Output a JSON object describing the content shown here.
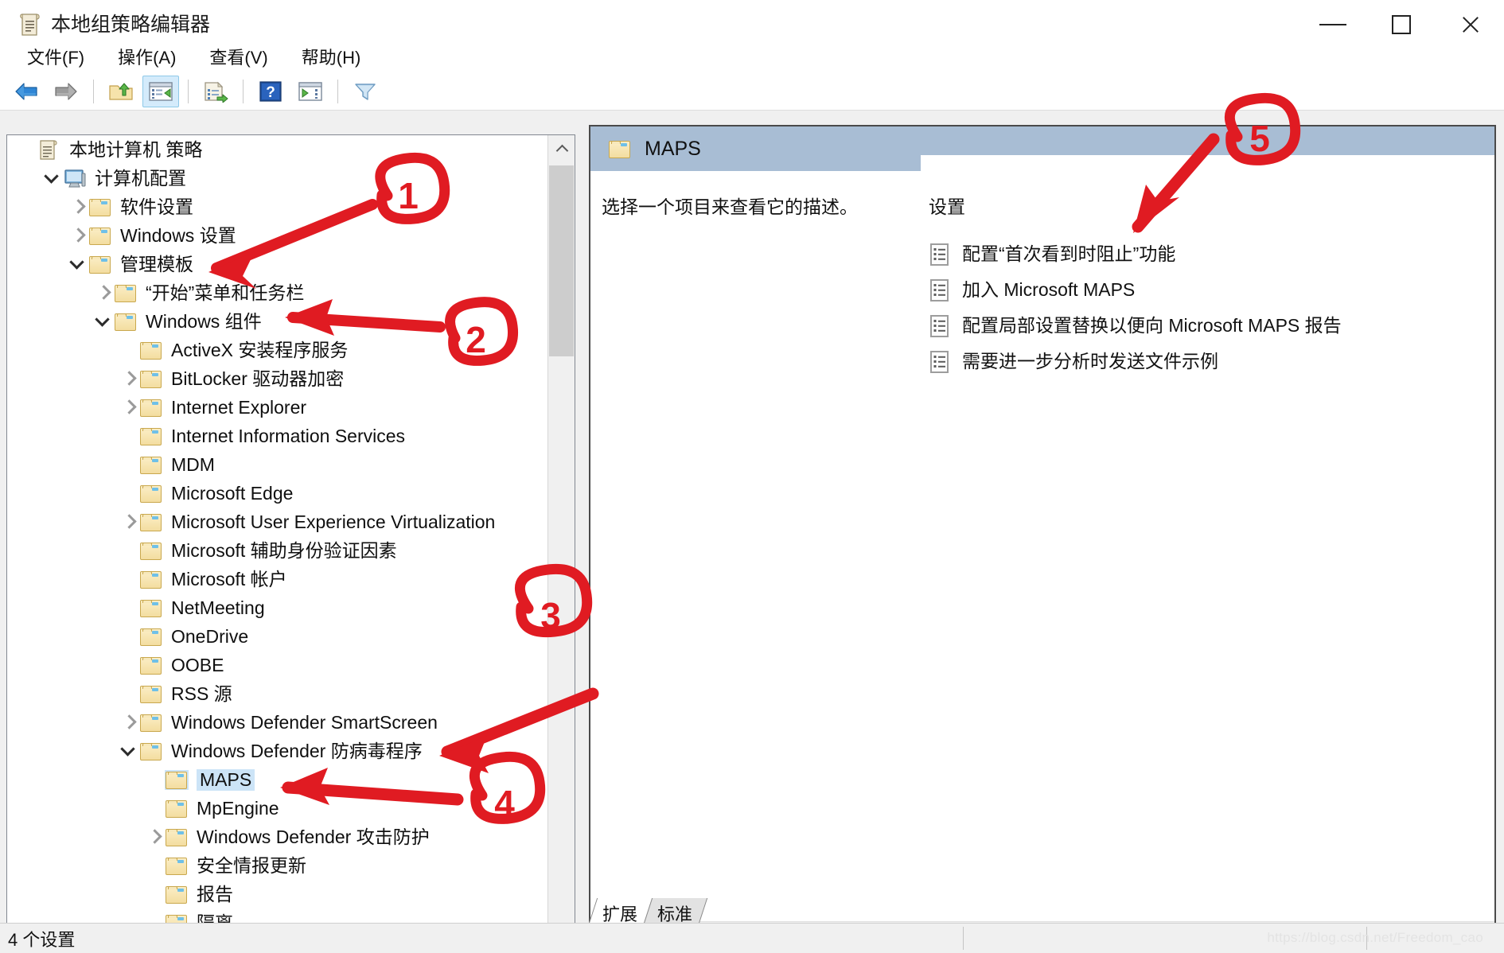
{
  "window": {
    "title": "本地组策略编辑器",
    "title_icon": "policy-scroll-icon",
    "controls": {
      "minimize": "最小化",
      "maximize": "最大化",
      "close": "关闭"
    }
  },
  "menubar": {
    "items": [
      {
        "label": "文件(F)",
        "name": "menu-file"
      },
      {
        "label": "操作(A)",
        "name": "menu-action"
      },
      {
        "label": "查看(V)",
        "name": "menu-view"
      },
      {
        "label": "帮助(H)",
        "name": "menu-help"
      }
    ]
  },
  "toolbar": {
    "buttons": [
      {
        "name": "back-button",
        "icon": "back-arrow-icon",
        "selected": false
      },
      {
        "name": "forward-button",
        "icon": "forward-arrow-icon",
        "selected": false
      },
      {
        "name": "up-folder-button",
        "icon": "up-folder-icon",
        "selected": false
      },
      {
        "name": "show-hide-tree-button",
        "icon": "console-tree-icon",
        "selected": true
      },
      {
        "name": "export-list-button",
        "icon": "export-list-icon",
        "selected": false
      },
      {
        "name": "help-button",
        "icon": "question-mark-icon",
        "selected": false
      },
      {
        "name": "show-pane-button",
        "icon": "show-pane-icon",
        "selected": false
      },
      {
        "name": "filter-button",
        "icon": "funnel-filter-icon",
        "selected": false
      }
    ]
  },
  "tree": {
    "items": [
      {
        "label": "本地计算机 策略",
        "depth": 0,
        "chev": "none",
        "icon": "policy-scroll-icon",
        "selected": false
      },
      {
        "label": "计算机配置",
        "depth": 1,
        "chev": "open",
        "icon": "computer-icon",
        "selected": false
      },
      {
        "label": "软件设置",
        "depth": 2,
        "chev": "closed",
        "icon": "folder-icon",
        "selected": false
      },
      {
        "label": "Windows 设置",
        "depth": 2,
        "chev": "closed",
        "icon": "folder-icon",
        "selected": false
      },
      {
        "label": "管理模板",
        "depth": 2,
        "chev": "open",
        "icon": "folder-icon",
        "selected": false
      },
      {
        "label": "“开始”菜单和任务栏",
        "depth": 3,
        "chev": "closed",
        "icon": "folder-icon",
        "selected": false
      },
      {
        "label": "Windows 组件",
        "depth": 3,
        "chev": "open",
        "icon": "folder-icon",
        "selected": false
      },
      {
        "label": "ActiveX 安装程序服务",
        "depth": 4,
        "chev": "none",
        "icon": "folder-icon",
        "selected": false
      },
      {
        "label": "BitLocker 驱动器加密",
        "depth": 4,
        "chev": "closed",
        "icon": "folder-icon",
        "selected": false
      },
      {
        "label": "Internet Explorer",
        "depth": 4,
        "chev": "closed",
        "icon": "folder-icon",
        "selected": false
      },
      {
        "label": "Internet Information Services",
        "depth": 4,
        "chev": "none",
        "icon": "folder-icon",
        "selected": false
      },
      {
        "label": "MDM",
        "depth": 4,
        "chev": "none",
        "icon": "folder-icon",
        "selected": false
      },
      {
        "label": "Microsoft Edge",
        "depth": 4,
        "chev": "none",
        "icon": "folder-icon",
        "selected": false
      },
      {
        "label": "Microsoft User Experience Virtualization",
        "depth": 4,
        "chev": "closed",
        "icon": "folder-icon",
        "selected": false
      },
      {
        "label": "Microsoft 辅助身份验证因素",
        "depth": 4,
        "chev": "none",
        "icon": "folder-icon",
        "selected": false
      },
      {
        "label": "Microsoft 帐户",
        "depth": 4,
        "chev": "none",
        "icon": "folder-icon",
        "selected": false
      },
      {
        "label": "NetMeeting",
        "depth": 4,
        "chev": "none",
        "icon": "folder-icon",
        "selected": false
      },
      {
        "label": "OneDrive",
        "depth": 4,
        "chev": "none",
        "icon": "folder-icon",
        "selected": false
      },
      {
        "label": "OOBE",
        "depth": 4,
        "chev": "none",
        "icon": "folder-icon",
        "selected": false
      },
      {
        "label": "RSS 源",
        "depth": 4,
        "chev": "none",
        "icon": "folder-icon",
        "selected": false
      },
      {
        "label": "Windows Defender SmartScreen",
        "depth": 4,
        "chev": "closed",
        "icon": "folder-icon",
        "selected": false
      },
      {
        "label": "Windows Defender 防病毒程序",
        "depth": 4,
        "chev": "open",
        "icon": "folder-icon",
        "selected": false
      },
      {
        "label": "MAPS",
        "depth": 5,
        "chev": "none",
        "icon": "folder-icon",
        "selected": true
      },
      {
        "label": "MpEngine",
        "depth": 5,
        "chev": "none",
        "icon": "folder-icon",
        "selected": false
      },
      {
        "label": "Windows Defender 攻击防护",
        "depth": 5,
        "chev": "closed",
        "icon": "folder-icon",
        "selected": false
      },
      {
        "label": "安全情报更新",
        "depth": 5,
        "chev": "none",
        "icon": "folder-icon",
        "selected": false
      },
      {
        "label": "报告",
        "depth": 5,
        "chev": "none",
        "icon": "folder-icon",
        "selected": false
      },
      {
        "label": "隔离",
        "depth": 5,
        "chev": "none",
        "icon": "folder-icon",
        "selected": false
      }
    ]
  },
  "details": {
    "header_title": "MAPS",
    "header_icon": "folder-icon",
    "description": "选择一个项目来查看它的描述。",
    "settings_column_title": "设置",
    "settings": [
      {
        "label": "配置“首次看到时阻止”功能",
        "icon": "policy-setting-icon"
      },
      {
        "label": "加入 Microsoft MAPS",
        "icon": "policy-setting-icon"
      },
      {
        "label": "配置局部设置替换以便向 Microsoft MAPS 报告",
        "icon": "policy-setting-icon"
      },
      {
        "label": "需要进一步分析时发送文件示例",
        "icon": "policy-setting-icon"
      }
    ]
  },
  "tabs": [
    {
      "label": "扩展",
      "name": "tab-extended",
      "active": true
    },
    {
      "label": "标准",
      "name": "tab-standard",
      "active": false
    }
  ],
  "statusbar": {
    "text": "4 个设置",
    "watermark": "https://blog.csdn.net/Freedom_cao"
  },
  "annotations": {
    "color": "#e01b22",
    "markers": [
      {
        "label": "1",
        "target": "管理模板"
      },
      {
        "label": "2",
        "target": "Windows 组件"
      },
      {
        "label": "3",
        "target": "Windows Defender 防病毒程序"
      },
      {
        "label": "4",
        "target": "MAPS"
      },
      {
        "label": "5",
        "target": "配置“首次看到时阻止”功能"
      }
    ]
  }
}
